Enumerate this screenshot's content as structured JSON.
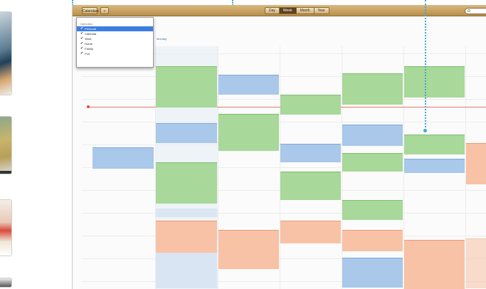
{
  "toolbar": {
    "calendars_label": "Calendars",
    "add_label": "+",
    "views": [
      "Day",
      "Week",
      "Month",
      "Year"
    ],
    "active_view": "Week"
  },
  "calendar_menu": {
    "heading": "Calendars",
    "items": [
      {
        "label": "Personal",
        "checked": true,
        "selected": true
      },
      {
        "label": "Calendar",
        "checked": true,
        "selected": false
      },
      {
        "label": "Work",
        "checked": true,
        "selected": false
      },
      {
        "label": "Home",
        "checked": true,
        "selected": false
      },
      {
        "label": "Family",
        "checked": true,
        "selected": false
      },
      {
        "label": "Fun",
        "checked": true,
        "selected": false
      }
    ]
  },
  "week": {
    "today_label": "Monday"
  },
  "colors": {
    "green": "#a8d89a",
    "blue": "#a9c8ea",
    "orange": "#f8c2a6",
    "toolbar": "#c7a063",
    "now": "#e34a3b",
    "callout": "#39a9dc"
  },
  "icons": [
    "check-icon",
    "search-icon",
    "now-indicator-icon"
  ]
}
